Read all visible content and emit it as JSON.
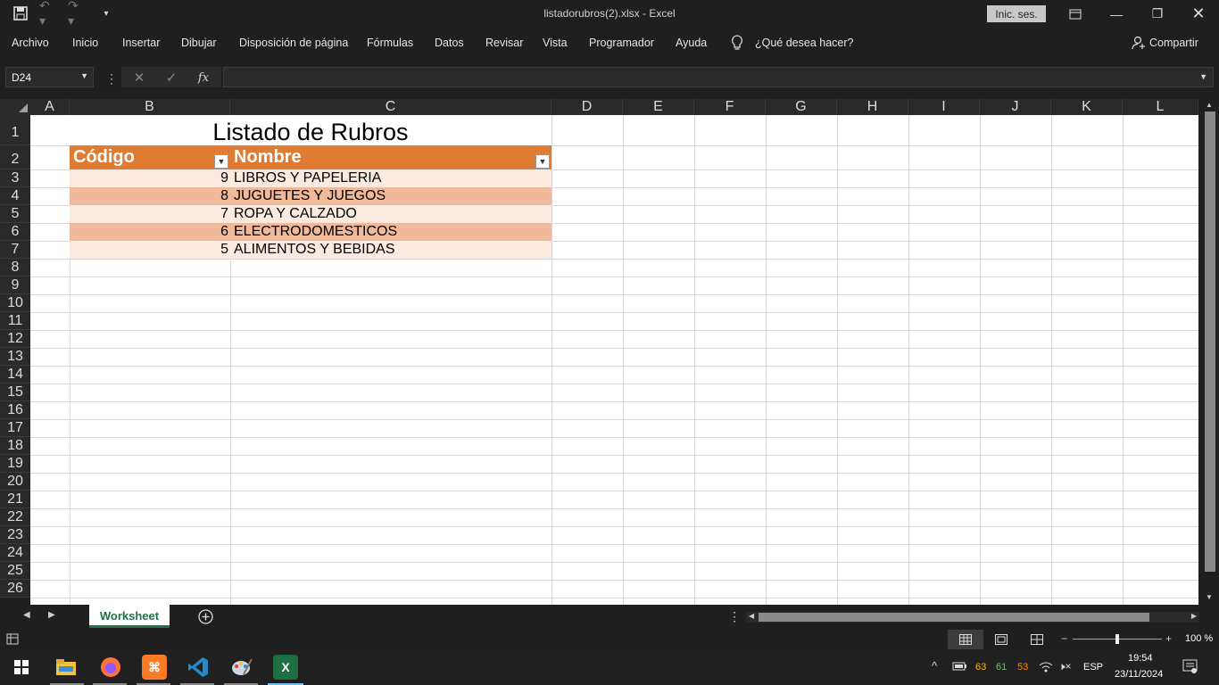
{
  "window": {
    "title": "listadorubros(2).xlsx  -  Excel",
    "signin_label": "Inic. ses."
  },
  "menu": {
    "items": [
      "Archivo",
      "Inicio",
      "Insertar",
      "Dibujar",
      "Disposición de página",
      "Fórmulas",
      "Datos",
      "Revisar",
      "Vista",
      "Programador",
      "Ayuda"
    ],
    "tell_me": "¿Qué desea hacer?",
    "share": "Compartir"
  },
  "formula_bar": {
    "name_box": "D24",
    "fx": "fx",
    "value": ""
  },
  "columns": [
    "A",
    "B",
    "C",
    "D",
    "E",
    "F",
    "G",
    "H",
    "I",
    "J",
    "K",
    "L"
  ],
  "rows": [
    "1",
    "2",
    "3",
    "4",
    "5",
    "6",
    "7",
    "8",
    "9",
    "10",
    "11",
    "12",
    "13",
    "14",
    "15",
    "16",
    "17",
    "18",
    "19",
    "20",
    "21",
    "22",
    "23",
    "24",
    "25",
    "26"
  ],
  "sheet": {
    "title": "Listado de Rubros",
    "table_headers": [
      "Código",
      "Nombre"
    ],
    "table_rows": [
      {
        "codigo": "9",
        "nombre": "LIBROS Y PAPELERIA"
      },
      {
        "codigo": "8",
        "nombre": "JUGUETES Y JUEGOS"
      },
      {
        "codigo": "7",
        "nombre": "ROPA Y CALZADO"
      },
      {
        "codigo": "6",
        "nombre": "ELECTRODOMESTICOS"
      },
      {
        "codigo": "5",
        "nombre": "ALIMENTOS Y BEBIDAS"
      }
    ],
    "colors": {
      "header": "#e07b34",
      "band_dark": "#f0b999",
      "band_light": "#fbeae0"
    }
  },
  "tabs": {
    "active": "Worksheet"
  },
  "status": {
    "zoom": "100 %",
    "zoom_level": 0.5
  },
  "taskbar": {
    "apps": [
      "file-explorer-icon",
      "firefox-icon",
      "xampp-icon",
      "vscode-icon",
      "paint-icon",
      "excel-icon"
    ],
    "tray_values": [
      "63",
      "61",
      "53"
    ],
    "language": "ESP",
    "time": "19:54",
    "date": "23/11/2024"
  }
}
